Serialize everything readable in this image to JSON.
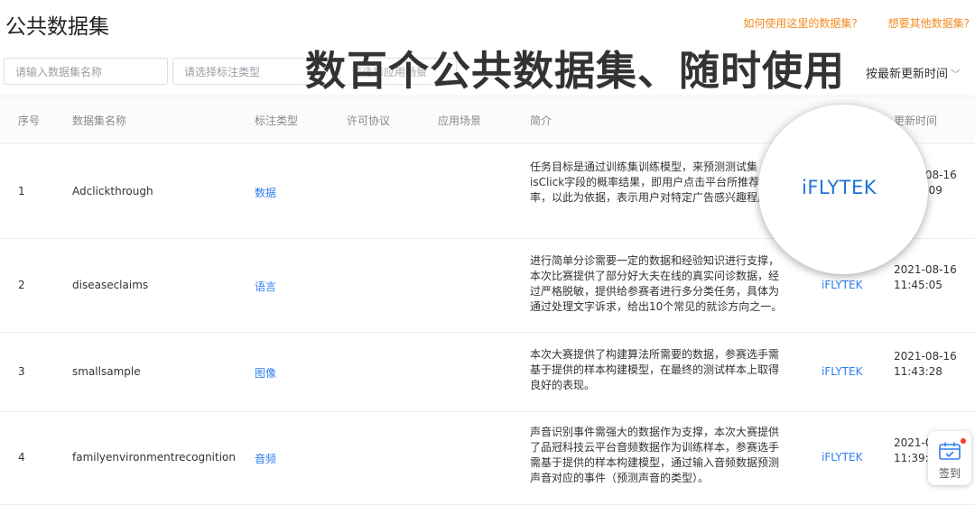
{
  "page": {
    "title": "公共数据集"
  },
  "top_links": {
    "how_to_use": "如何使用这里的数据集?",
    "want_more": "想要其他数据集?"
  },
  "filters": {
    "name_placeholder": "请输入数据集名称",
    "type_placeholder": "请选择标注类型",
    "scene_placeholder": "请选择应用场景",
    "sort_label": "按最新更新时间"
  },
  "banner": {
    "text": "数百个公共数据集、随时使用"
  },
  "table": {
    "headers": [
      "序号",
      "数据集名称",
      "标注类型",
      "许可协议",
      "应用场景",
      "简介",
      "更新时间"
    ],
    "rows": [
      {
        "index": "1",
        "name": "Adclickthrough",
        "type": "数据",
        "description": "任务目标是通过训练集训练模型，来预测测试集isClick字段的概率结果，即用户点击平台所推荐的概率，以此为依据，表示用户对特定广告感兴趣程度。",
        "org": "",
        "time": "2021-08-16 11:47:09"
      },
      {
        "index": "2",
        "name": "diseaseclaims",
        "type": "语言",
        "description": "进行简单分诊需要一定的数据和经验知识进行支撑，本次比赛提供了部分好大夫在线的真实问诊数据，经过严格脱敏，提供给参赛者进行多分类任务，具体为通过处理文字诉求，给出10个常见的就诊方向之一。",
        "org": "iFLYTEK",
        "time": "2021-08-16 11:45:05"
      },
      {
        "index": "3",
        "name": "smallsample",
        "type": "图像",
        "description": "本次大赛提供了构建算法所需要的数据，参赛选手需基于提供的样本构建模型，在最终的测试样本上取得良好的表现。",
        "org": "iFLYTEK",
        "time": "2021-08-16 11:43:28"
      },
      {
        "index": "4",
        "name": "familyenvironmentrecognition",
        "type": "音频",
        "description": "声音识别事件需强大的数据作为支撑，本次大赛提供了品冠科技云平台音频数据作为训练样本，参赛选手需基于提供的样本构建模型，通过输入音频数据预测声音对应的事件（预测声音的类型）。",
        "org": "iFLYTEK",
        "time": "2021-08-16 11:39:"
      }
    ]
  },
  "magnifier": {
    "text": "iFLYTEK"
  },
  "signin": {
    "label": "签到"
  },
  "colors": {
    "accent": "#2f7ff0",
    "link_orange": "#f58a1f",
    "badge_red": "#ff3b30"
  }
}
